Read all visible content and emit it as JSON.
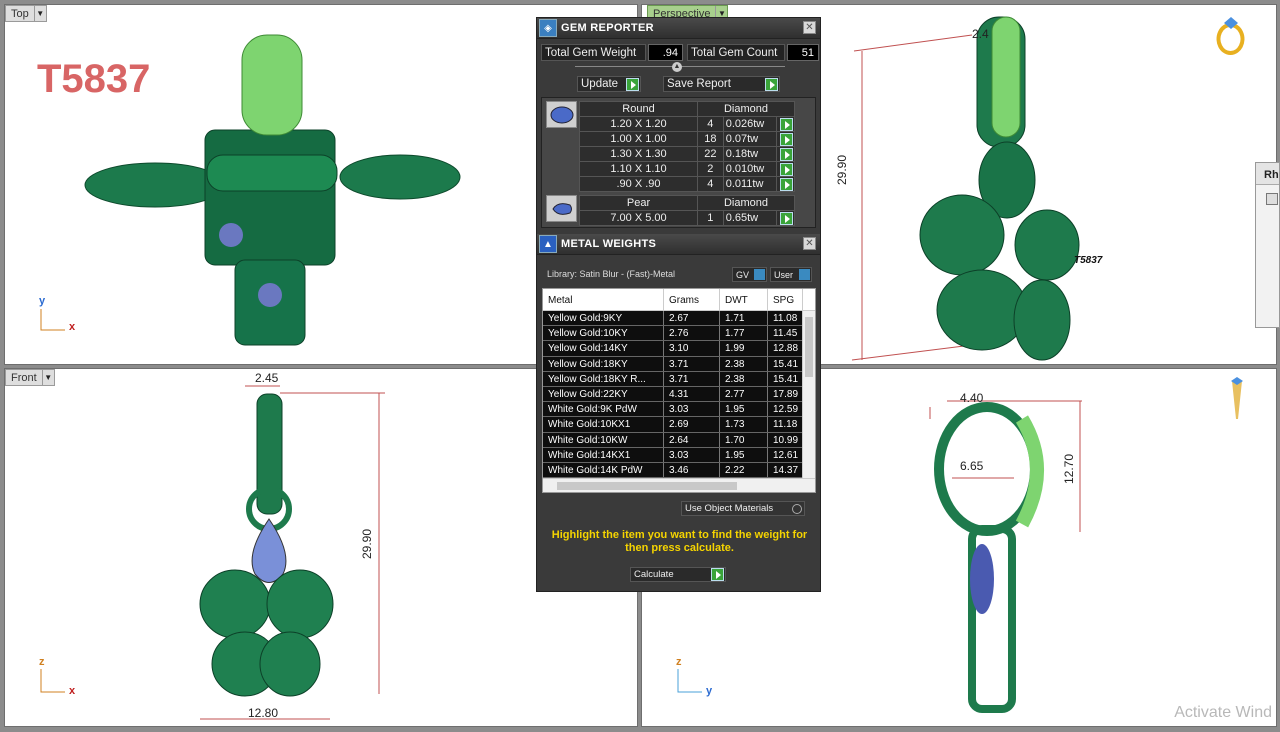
{
  "viewports": {
    "top": {
      "label": "Top",
      "code": "T5837",
      "axis_y": "y",
      "axis_x": "x"
    },
    "perspective": {
      "label": "Perspective",
      "dim_top": "2.4",
      "dim_height": "29.90",
      "engrave": "T5837"
    },
    "front": {
      "label": "Front",
      "dim_top": "2.45",
      "dim_height": "29.90",
      "dim_width": "12.80",
      "axis_z": "z",
      "axis_x": "x"
    },
    "right": {
      "dim_top": "4.40",
      "dim_inner": "6.65",
      "dim_height": "12.70",
      "axis_z": "z",
      "axis_y": "y",
      "watermark": "Activate Wind"
    }
  },
  "side_panel": {
    "title": "Rh"
  },
  "gem_reporter": {
    "title": "GEM REPORTER",
    "total_weight_label": "Total Gem Weight",
    "total_weight": ".94",
    "total_count_label": "Total Gem Count",
    "total_count": "51",
    "update_label": "Update",
    "save_label": "Save Report",
    "groups": [
      {
        "shape": "Round",
        "material": "Diamond",
        "rows": [
          {
            "size": "1.20 X 1.20",
            "count": "4",
            "weight": "0.026tw"
          },
          {
            "size": "1.00 X 1.00",
            "count": "18",
            "weight": "0.07tw"
          },
          {
            "size": "1.30 X 1.30",
            "count": "22",
            "weight": "0.18tw"
          },
          {
            "size": "1.10 X 1.10",
            "count": "2",
            "weight": "0.010tw"
          },
          {
            "size": ".90 X .90",
            "count": "4",
            "weight": "0.011tw"
          }
        ]
      },
      {
        "shape": "Pear",
        "material": "Diamond",
        "rows": [
          {
            "size": "7.00 X 5.00",
            "count": "1",
            "weight": "0.65tw"
          }
        ]
      }
    ]
  },
  "metal_weights": {
    "title": "METAL WEIGHTS",
    "library": "Library: Satin Blur - (Fast)-Metal",
    "gv_label": "GV",
    "user_label": "User",
    "columns": [
      "Metal",
      "Grams",
      "DWT",
      "SPG"
    ],
    "rows": [
      [
        "Yellow Gold:9KY",
        "2.67",
        "1.71",
        "11.08"
      ],
      [
        "Yellow Gold:10KY",
        "2.76",
        "1.77",
        "11.45"
      ],
      [
        "Yellow Gold:14KY",
        "3.10",
        "1.99",
        "12.88"
      ],
      [
        "Yellow Gold:18KY",
        "3.71",
        "2.38",
        "15.41"
      ],
      [
        "Yellow Gold:18KY R...",
        "3.71",
        "2.38",
        "15.41"
      ],
      [
        "Yellow Gold:22KY",
        "4.31",
        "2.77",
        "17.89"
      ],
      [
        "White Gold:9K PdW",
        "3.03",
        "1.95",
        "12.59"
      ],
      [
        "White Gold:10KX1",
        "2.69",
        "1.73",
        "11.18"
      ],
      [
        "White Gold:10KW",
        "2.64",
        "1.70",
        "10.99"
      ],
      [
        "White Gold:14KX1",
        "3.03",
        "1.95",
        "12.61"
      ],
      [
        "White Gold:14K PdW",
        "3.46",
        "2.22",
        "14.37"
      ]
    ],
    "use_object_materials": "Use Object Materials",
    "note": "Highlight the item you want to find the weight for then press calculate.",
    "calculate_label": "Calculate"
  }
}
